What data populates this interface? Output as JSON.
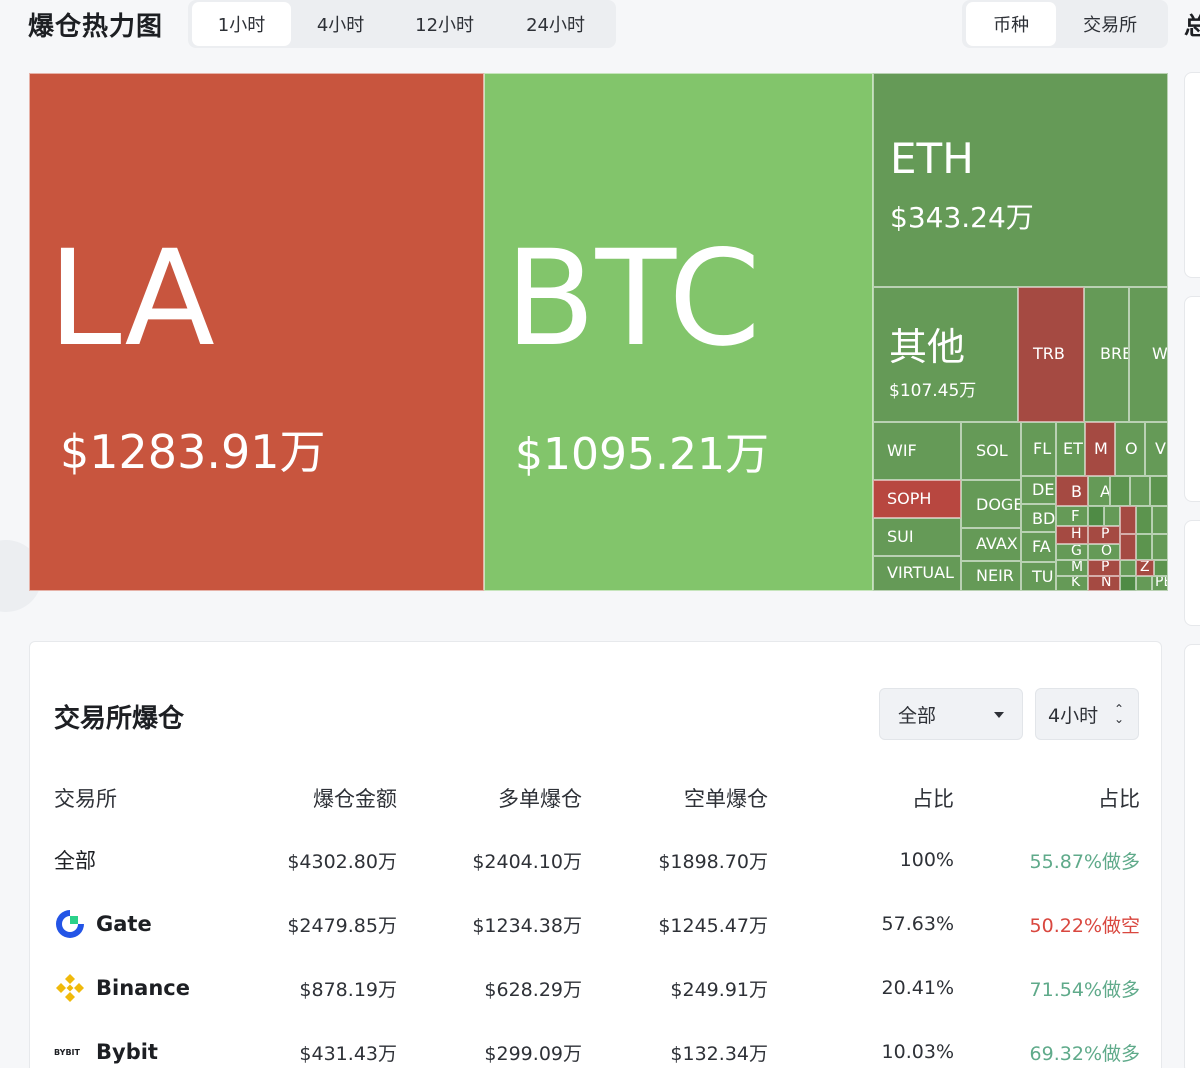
{
  "header": {
    "title": "爆仓热力图",
    "time_tabs": [
      "1小时",
      "4小时",
      "12小时",
      "24小时"
    ],
    "type_tabs": [
      "币种",
      "交易所"
    ],
    "edge_text": "总"
  },
  "treemap": {
    "la": {
      "symbol": "LA",
      "amount": "$1283.91万"
    },
    "btc": {
      "symbol": "BTC",
      "amount": "$1095.21万"
    },
    "eth": {
      "symbol": "ETH",
      "amount": "$343.24万"
    },
    "other": {
      "symbol": "其他",
      "amount": "$107.45万"
    },
    "labels": {
      "trb": "TRB",
      "bre": "BRE",
      "wl": "WL",
      "wif": "WIF",
      "sol": "SOL",
      "fl": "FL",
      "et": "ET",
      "m": "M",
      "o": "O",
      "v": "V",
      "soph": "SOPH",
      "doge": "DOGE",
      "de": "DE",
      "b": "B",
      "a": "A",
      "sui": "SUI",
      "avax": "AVAX",
      "bd": "BD",
      "f": "F",
      "fa": "FA",
      "h": "H",
      "p": "P",
      "g": "G",
      "o2": "O",
      "virtual": "VIRTUAL",
      "neir": "NEIR",
      "tu": "TU",
      "m2": "M",
      "p2": "P",
      "z": "Z",
      "k": "K",
      "n": "N",
      "pe": "PE"
    }
  },
  "exchange_panel": {
    "title": "交易所爆仓",
    "filter": "全部",
    "period": "4小时",
    "columns": [
      "交易所",
      "爆仓金额",
      "多单爆仓",
      "空单爆仓",
      "占比",
      "占比"
    ],
    "rows": [
      {
        "name": "全部",
        "total": "$4302.80万",
        "long": "$2404.10万",
        "short": "$1898.70万",
        "share": "100%",
        "ratio": "55.87%做多"
      },
      {
        "name": "Gate",
        "total": "$2479.85万",
        "long": "$1234.38万",
        "short": "$1245.47万",
        "share": "57.63%",
        "ratio": "50.22%做空"
      },
      {
        "name": "Binance",
        "total": "$878.19万",
        "long": "$628.29万",
        "short": "$249.91万",
        "share": "20.41%",
        "ratio": "71.54%做多"
      },
      {
        "name": "Bybit",
        "total": "$431.43万",
        "long": "$299.09万",
        "short": "$132.34万",
        "share": "10.03%",
        "ratio": "69.32%做多"
      }
    ],
    "bybit_logo_text": "BYBIT"
  },
  "colors": {
    "long_green": "#5faa8a",
    "short_red": "#d9473f",
    "la_red": "#c8553e",
    "btc_green": "#82c56b",
    "eth_green": "#659a57",
    "gate_blue": "#2354e6",
    "binance_yellow": "#f0b90b"
  }
}
